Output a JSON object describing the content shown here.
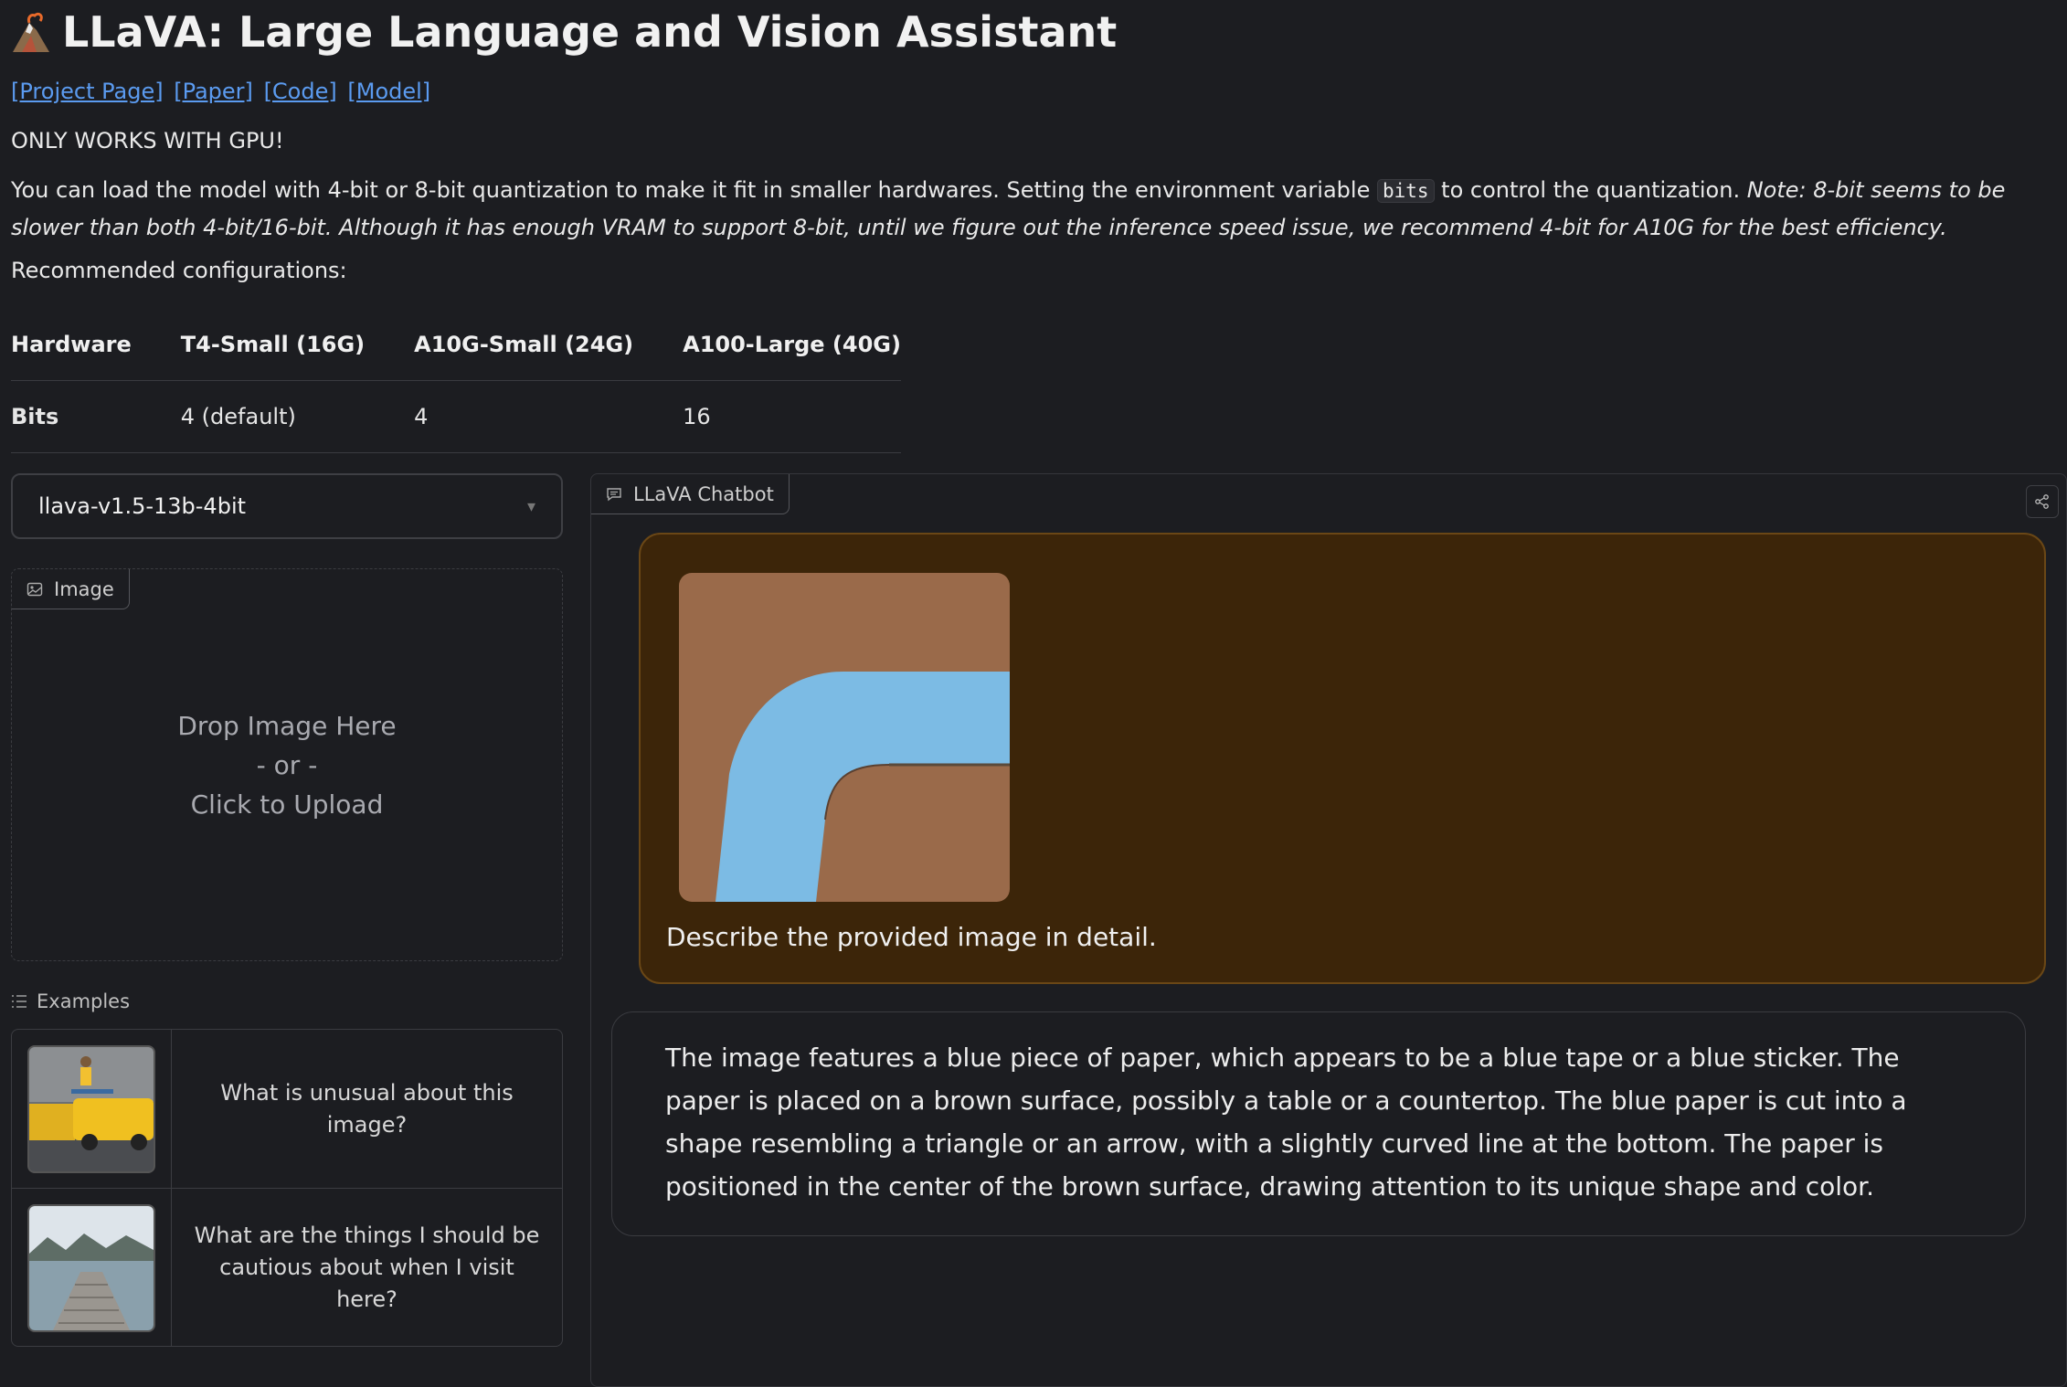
{
  "header": {
    "title": "LLaVA: Large Language and Vision Assistant",
    "logo_icon": "volcano-logo-icon"
  },
  "links": [
    "[Project Page]",
    "[Paper]",
    "[Code]",
    "[Model]"
  ],
  "gpu_notice": "ONLY WORKS WITH GPU!",
  "description": {
    "part1": "You can load the model with 4-bit or 8-bit quantization to make it fit in smaller hardwares. Setting the environment variable ",
    "code": "bits",
    "part2": " to control the quantization. ",
    "note": "Note: 8-bit seems to be slower than both 4-bit/16-bit. Although it has enough VRAM to support 8-bit, until we figure out the inference speed issue, we recommend 4-bit for A10G for the best efficiency."
  },
  "recommended_label": "Recommended configurations:",
  "config_table": {
    "headers": [
      "Hardware",
      "T4-Small (16G)",
      "A10G-Small (24G)",
      "A100-Large (40G)"
    ],
    "row": [
      "Bits",
      "4 (default)",
      "4",
      "16"
    ]
  },
  "model_select": {
    "value": "llava-v1.5-13b-4bit"
  },
  "image_panel": {
    "label": "Image",
    "drop_line1": "Drop Image Here",
    "drop_line2": "- or -",
    "drop_line3": "Click to Upload"
  },
  "examples": {
    "label": "Examples",
    "items": [
      {
        "text": "What is unusual about this image?",
        "thumb": "taxi-ironing-thumb"
      },
      {
        "text": "What are the things I should be cautious about when I visit here?",
        "thumb": "lake-pier-thumb"
      }
    ]
  },
  "chatbot": {
    "label": "LLaVA Chatbot",
    "user_message": "Describe the provided image in detail.",
    "bot_message": "The image features a blue piece of paper, which appears to be a blue tape or a blue sticker. The paper is placed on a brown surface, possibly a table or a countertop. The blue paper is cut into a shape resembling a triangle or an arrow, with a slightly curved line at the bottom. The paper is positioned in the center of the brown surface, drawing attention to its unique shape and color."
  },
  "colors": {
    "background": "#1c1d21",
    "link": "#5b9bf0",
    "user_bubble": "#3c2509",
    "user_bubble_border": "#6a4716"
  }
}
